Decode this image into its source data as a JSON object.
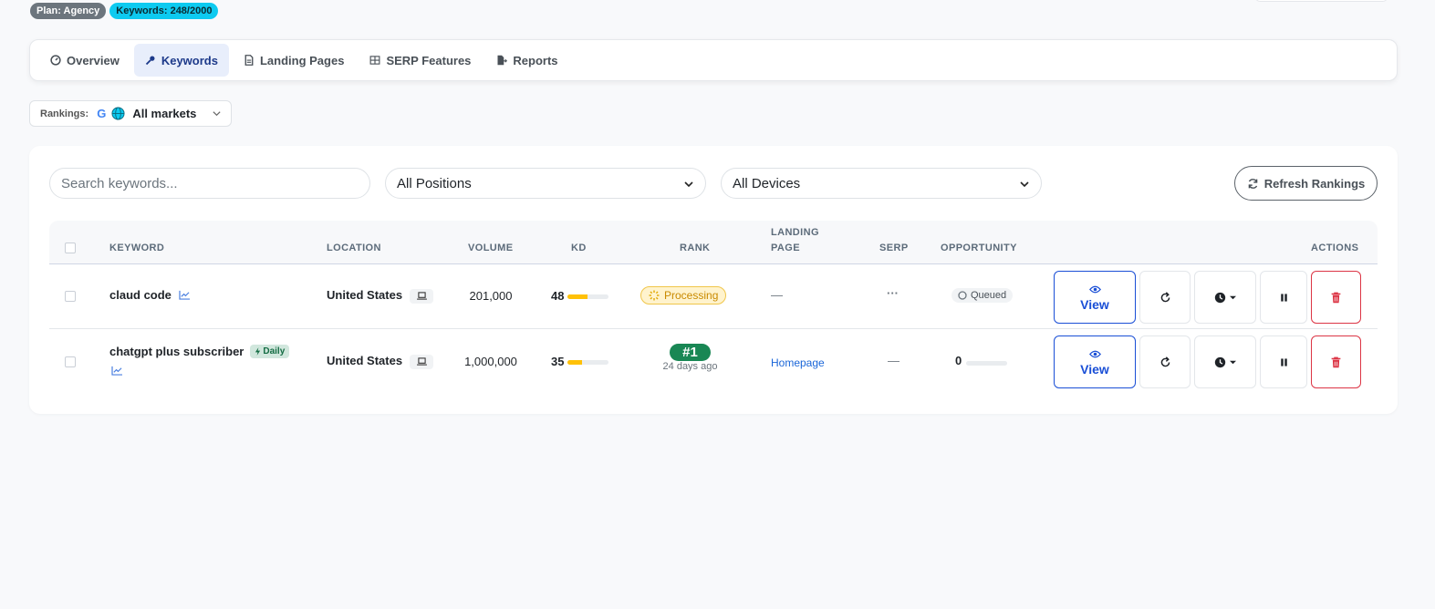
{
  "header": {
    "plan_badge": "Plan: Agency",
    "keywords_badge": "Keywords: 248/2000"
  },
  "tabs": [
    {
      "label": "Overview",
      "icon": "gauge-icon",
      "active": false
    },
    {
      "label": "Keywords",
      "icon": "key-icon",
      "active": true
    },
    {
      "label": "Landing Pages",
      "icon": "file-icon",
      "active": false
    },
    {
      "label": "SERP Features",
      "icon": "grid-icon",
      "active": false
    },
    {
      "label": "Reports",
      "icon": "file-export-icon",
      "active": false
    }
  ],
  "rankings": {
    "label": "Rankings:",
    "engine": "G",
    "market": "All markets"
  },
  "filters": {
    "search_placeholder": "Search keywords...",
    "positions": "All Positions",
    "devices": "All Devices",
    "refresh_label": "Refresh Rankings"
  },
  "table": {
    "headers": {
      "keyword": "KEYWORD",
      "location": "LOCATION",
      "volume": "VOLUME",
      "kd": "KD",
      "rank": "RANK",
      "landing_line1": "LANDING",
      "landing_line2": "PAGE",
      "serp": "SERP",
      "opportunity": "OPPORTUNITY",
      "actions": "ACTIONS"
    },
    "rows": [
      {
        "keyword": "claud code",
        "location": "United States",
        "volume": "201,000",
        "kd": "48",
        "kd_fill": 0.48,
        "rank_status": "Processing",
        "landing": "—",
        "serp": "···",
        "opportunity": "Queued",
        "view_label": "View"
      },
      {
        "keyword": "chatgpt plus subscriber",
        "frequency": "Daily",
        "location": "United States",
        "volume": "1,000,000",
        "kd": "35",
        "kd_fill": 0.35,
        "rank": "#1",
        "rank_age": "24 days ago",
        "landing": "Homepage",
        "serp": "—",
        "opportunity": "0",
        "view_label": "View"
      }
    ]
  },
  "colors": {
    "accent": "#1a4fd6",
    "success": "#198754",
    "danger": "#dc3545",
    "warning": "#ffc107",
    "info": "#0dcaf0"
  }
}
